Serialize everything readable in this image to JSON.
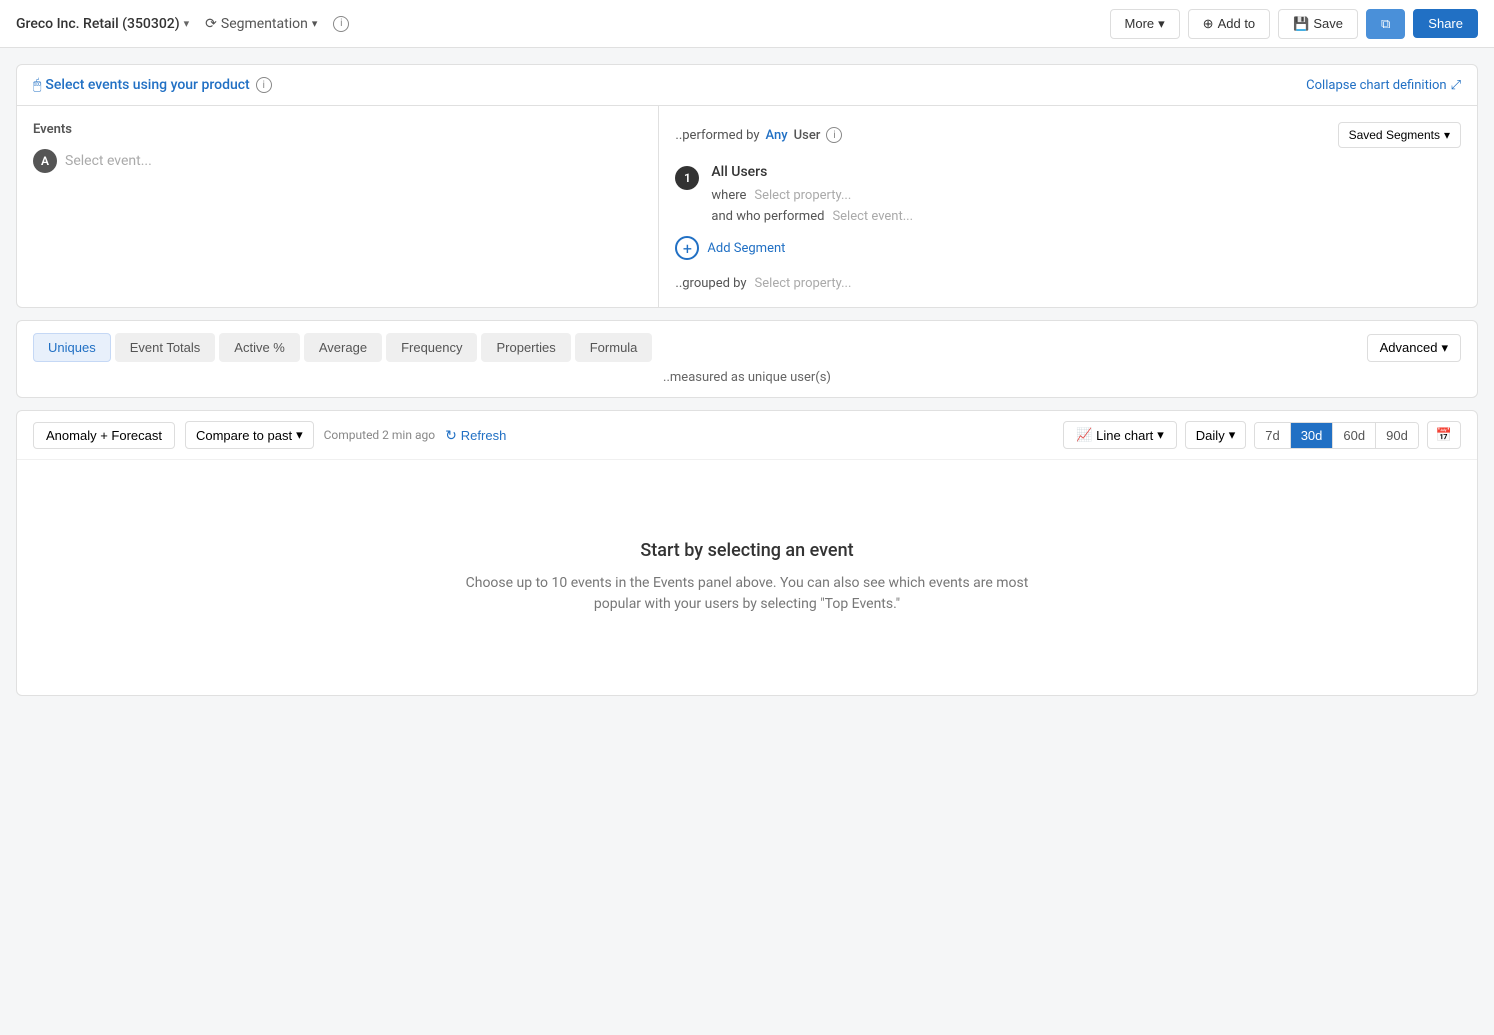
{
  "topNav": {
    "orgName": "Greco Inc. Retail (350302)",
    "segmentation": "Segmentation",
    "moreLabel": "More",
    "addToLabel": "Add to",
    "saveLabel": "Save",
    "shareLabel": "Share"
  },
  "chartDef": {
    "selectEventsLabel": "Select events using your product",
    "collapseLabel": "Collapse chart definition",
    "eventsSection": {
      "label": "Events",
      "eventBadge": "A",
      "selectEventPlaceholder": "Select event..."
    },
    "performedBySection": {
      "prefix": "..performed by",
      "any": "Any",
      "user": "User",
      "savedSegmentsLabel": "Saved Segments",
      "segment": {
        "number": "1",
        "title": "All Users",
        "whereLabel": "where",
        "selectPropertyPlaceholder": "Select property...",
        "andWhoPerformedLabel": "and who performed",
        "selectEventPlaceholder": "Select event..."
      },
      "addSegmentLabel": "Add Segment",
      "groupedByLabel": "..grouped by",
      "groupedBySelectPlaceholder": "Select property..."
    }
  },
  "metricsTabs": {
    "tabs": [
      {
        "id": "uniques",
        "label": "Uniques",
        "active": true
      },
      {
        "id": "event-totals",
        "label": "Event Totals",
        "active": false
      },
      {
        "id": "active-pct",
        "label": "Active %",
        "active": false
      },
      {
        "id": "average",
        "label": "Average",
        "active": false
      },
      {
        "id": "frequency",
        "label": "Frequency",
        "active": false
      },
      {
        "id": "properties",
        "label": "Properties",
        "active": false
      },
      {
        "id": "formula",
        "label": "Formula",
        "active": false
      }
    ],
    "advancedLabel": "Advanced",
    "measuredAsText": "..measured as unique user(s)"
  },
  "chartPanel": {
    "anomalyLabel": "Anomaly + Forecast",
    "compareLabel": "Compare to past",
    "computedText": "Computed 2 min ago",
    "refreshLabel": "Refresh",
    "chartTypeLabel": "Line chart",
    "intervalLabel": "Daily",
    "timeRanges": [
      {
        "label": "7d",
        "active": false
      },
      {
        "label": "30d",
        "active": true
      },
      {
        "label": "60d",
        "active": false
      },
      {
        "label": "90d",
        "active": false
      }
    ],
    "emptyState": {
      "title": "Start by selecting an event",
      "description": "Choose up to 10 events in the Events panel above. You can also see which events are most popular with your users by selecting \"Top Events.\""
    }
  }
}
